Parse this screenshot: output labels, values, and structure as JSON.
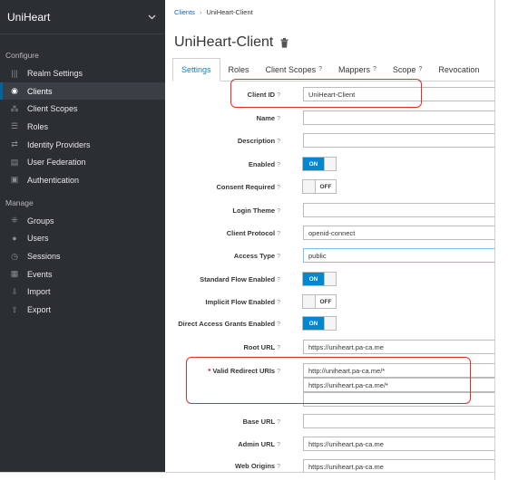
{
  "realm": {
    "name": "UniHeart"
  },
  "sidebar": {
    "configure_label": "Configure",
    "manage_label": "Manage",
    "configure_items": [
      {
        "label": "Realm Settings",
        "icon": "sliders-icon"
      },
      {
        "label": "Clients",
        "icon": "cube-icon"
      },
      {
        "label": "Client Scopes",
        "icon": "network-icon"
      },
      {
        "label": "Roles",
        "icon": "list-icon"
      },
      {
        "label": "Identity Providers",
        "icon": "exchange-icon"
      },
      {
        "label": "User Federation",
        "icon": "database-icon"
      },
      {
        "label": "Authentication",
        "icon": "lock-icon"
      }
    ],
    "manage_items": [
      {
        "label": "Groups",
        "icon": "group-icon"
      },
      {
        "label": "Users",
        "icon": "user-icon"
      },
      {
        "label": "Sessions",
        "icon": "clock-icon"
      },
      {
        "label": "Events",
        "icon": "calendar-icon"
      },
      {
        "label": "Import",
        "icon": "import-icon"
      },
      {
        "label": "Export",
        "icon": "export-icon"
      }
    ],
    "active_item": "Clients"
  },
  "breadcrumb": {
    "parent": "Clients",
    "current": "UniHeart-Client"
  },
  "page_title": "UniHeart-Client",
  "tabs": [
    {
      "label": "Settings"
    },
    {
      "label": "Roles"
    },
    {
      "label": "Client Scopes",
      "help": "?"
    },
    {
      "label": "Mappers",
      "help": "?"
    },
    {
      "label": "Scope",
      "help": "?"
    },
    {
      "label": "Revocation"
    }
  ],
  "form": {
    "client_id": {
      "label": "Client ID",
      "value": "UniHeart-Client"
    },
    "name": {
      "label": "Name",
      "value": ""
    },
    "description": {
      "label": "Description",
      "value": ""
    },
    "enabled": {
      "label": "Enabled",
      "state": "ON"
    },
    "consent_required": {
      "label": "Consent Required",
      "state": "OFF"
    },
    "login_theme": {
      "label": "Login Theme",
      "value": ""
    },
    "client_protocol": {
      "label": "Client Protocol",
      "value": "openid-connect"
    },
    "access_type": {
      "label": "Access Type",
      "value": "public"
    },
    "standard_flow": {
      "label": "Standard Flow Enabled",
      "state": "ON"
    },
    "implicit_flow": {
      "label": "Implicit Flow Enabled",
      "state": "OFF"
    },
    "direct_access": {
      "label": "Direct Access Grants Enabled",
      "state": "ON"
    },
    "root_url": {
      "label": "Root URL",
      "value": "https://uniheart.pa-ca.me"
    },
    "valid_redirect_uris": {
      "label": "Valid Redirect URIs",
      "required_mark": "*",
      "values": [
        "http://uniheart.pa-ca.me/*",
        "https://uniheart.pa-ca.me/*",
        ""
      ]
    },
    "base_url": {
      "label": "Base URL",
      "value": ""
    },
    "admin_url": {
      "label": "Admin URL",
      "value": "https://uniheart.pa-ca.me"
    },
    "web_origins": {
      "label": "Web Origins",
      "value": "https://uniheart.pa-ca.me"
    },
    "help_glyph": "?"
  },
  "colors": {
    "sidebar_bg": "#2b2f33",
    "accent": "#0088ce",
    "highlight": "#e0302a"
  }
}
